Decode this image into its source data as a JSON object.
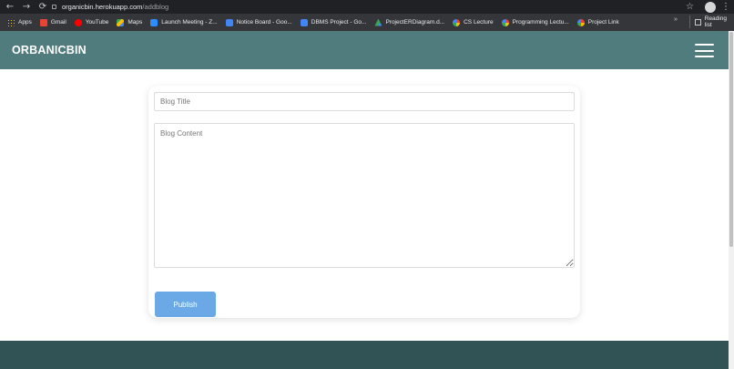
{
  "browser": {
    "nav": {
      "back": "←",
      "forward": "→",
      "reload": "⟳"
    },
    "url_host": "organicbin.herokuapp.com",
    "url_path": "/addblog",
    "star": "☆",
    "menu": "⋮",
    "bookmarks": [
      {
        "label": "Apps",
        "icon": "apps-grid-icon"
      },
      {
        "label": "Gmail",
        "icon": "gmail-icon"
      },
      {
        "label": "YouTube",
        "icon": "youtube-icon"
      },
      {
        "label": "Maps",
        "icon": "maps-icon"
      },
      {
        "label": "Launch Meeting - Z...",
        "icon": "zoom-icon"
      },
      {
        "label": "Notice Board - Goo...",
        "icon": "google-doc-icon"
      },
      {
        "label": "DBMS Project - Go...",
        "icon": "google-doc-icon"
      },
      {
        "label": "ProjectERDiagram.d...",
        "icon": "google-drive-icon"
      },
      {
        "label": "CS Lecture",
        "icon": "google-classroom-icon"
      },
      {
        "label": "Programming Lectu...",
        "icon": "google-classroom-icon"
      },
      {
        "label": "Project Link",
        "icon": "google-classroom-icon"
      }
    ],
    "more_bookmarks": "»",
    "reading_list": "Reading list"
  },
  "site": {
    "brand": "ORBANICBIN",
    "header_color": "#517c7d",
    "footer_color": "#325355"
  },
  "form": {
    "title_placeholder": "Blog Title",
    "content_placeholder": "Blog Content",
    "publish_label": "Publish",
    "publish_color": "#6aa9e5"
  }
}
